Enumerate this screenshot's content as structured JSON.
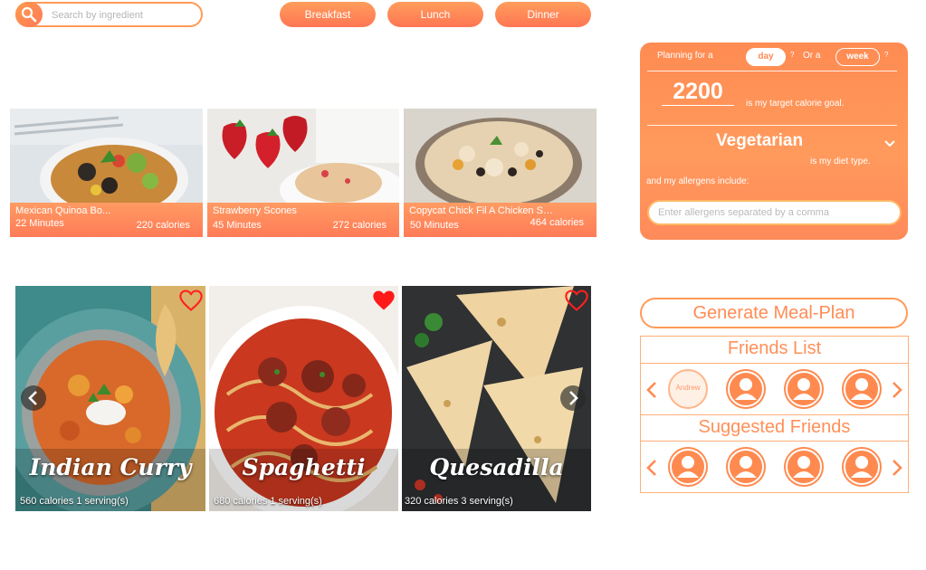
{
  "search": {
    "placeholder": "Search by ingredient",
    "icon": "search-icon"
  },
  "meal_tabs": [
    {
      "label": "Breakfast"
    },
    {
      "label": "Lunch"
    },
    {
      "label": "Dinner"
    }
  ],
  "recipe_cards": [
    {
      "title": "Mexican Quinoa Bo...",
      "minutes": "22 Minutes",
      "calories": "220 calories"
    },
    {
      "title": "Strawberry Scones",
      "minutes": "45 Minutes",
      "calories": "272 calories"
    },
    {
      "title": "Copycat Chick Fil A Chicken Sa...",
      "minutes": "50 Minutes",
      "calories": "464 calories"
    }
  ],
  "favorites": [
    {
      "name": "Indian Curry",
      "info": "560 calories 1 serving(s)",
      "liked": false
    },
    {
      "name": "Spaghetti",
      "info": "680 calories 1 serving(s)",
      "liked": true
    },
    {
      "name": "Quesadilla",
      "info": "320 calories 3 serving(s)",
      "liked": false
    }
  ],
  "planner": {
    "planning_label": "Planning for a",
    "day_label": "day",
    "q1": "?",
    "or_label": "Or a",
    "week_label": "week",
    "q2": "?",
    "calories": "2200",
    "calorie_text": "is my target calorie goal.",
    "diet": "Vegetarian",
    "diet_text": "is my diet type.",
    "allergen_label": "and my allergens include:",
    "allergen_placeholder": "Enter allergens separated by a comma"
  },
  "generate_label": "Generate Meal-Plan",
  "friends": {
    "title": "Friends List",
    "first_name": "Andrew"
  },
  "suggested": {
    "title": "Suggested Friends"
  },
  "colors": {
    "accent": "#ff8a50",
    "heart_liked": "#ff1a1a"
  }
}
